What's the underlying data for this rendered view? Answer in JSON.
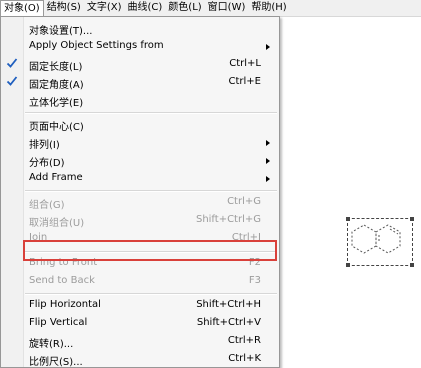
{
  "menubar": {
    "items": [
      {
        "label": "对象(O)"
      },
      {
        "label": "结构(S)"
      },
      {
        "label": "文字(X)"
      },
      {
        "label": "曲线(C)"
      },
      {
        "label": "颜色(L)"
      },
      {
        "label": "窗口(W)"
      },
      {
        "label": "帮助(H)"
      }
    ]
  },
  "menu": {
    "items": [
      {
        "label": "对象设置(T)...",
        "shortcut": "",
        "checked": false,
        "submenu": false,
        "disabled": false
      },
      {
        "label": "Apply Object Settings from",
        "shortcut": "",
        "checked": false,
        "submenu": true,
        "disabled": false
      },
      {
        "label": "固定长度(L)",
        "shortcut": "Ctrl+L",
        "checked": true,
        "submenu": false,
        "disabled": false
      },
      {
        "label": "固定角度(A)",
        "shortcut": "Ctrl+E",
        "checked": true,
        "submenu": false,
        "disabled": false
      },
      {
        "label": "立体化学(E)",
        "shortcut": "",
        "checked": false,
        "submenu": false,
        "disabled": false
      },
      {
        "label": "页面中心(C)",
        "shortcut": "",
        "checked": false,
        "submenu": false,
        "disabled": false
      },
      {
        "label": "排列(I)",
        "shortcut": "",
        "checked": false,
        "submenu": true,
        "disabled": false
      },
      {
        "label": "分布(D)",
        "shortcut": "",
        "checked": false,
        "submenu": true,
        "disabled": false
      },
      {
        "label": "Add Frame",
        "shortcut": "",
        "checked": false,
        "submenu": true,
        "disabled": false
      },
      {
        "label": "组合(G)",
        "shortcut": "Ctrl+G",
        "checked": false,
        "submenu": false,
        "disabled": true
      },
      {
        "label": "取消组合(U)",
        "shortcut": "Shift+Ctrl+G",
        "checked": false,
        "submenu": false,
        "disabled": true
      },
      {
        "label": "Join",
        "shortcut": "Ctrl+J",
        "checked": false,
        "submenu": false,
        "disabled": true
      },
      {
        "label": "Bring to Front",
        "shortcut": "F2",
        "checked": false,
        "submenu": false,
        "disabled": true
      },
      {
        "label": "Send to Back",
        "shortcut": "F3",
        "checked": false,
        "submenu": false,
        "disabled": true
      },
      {
        "label": "Flip Horizontal",
        "shortcut": "Shift+Ctrl+H",
        "checked": false,
        "submenu": false,
        "disabled": false
      },
      {
        "label": "Flip Vertical",
        "shortcut": "Shift+Ctrl+V",
        "checked": false,
        "submenu": false,
        "disabled": false
      },
      {
        "label": "旋转(R)...",
        "shortcut": "Ctrl+R",
        "checked": false,
        "submenu": false,
        "disabled": false
      },
      {
        "label": "比例尺(S)...",
        "shortcut": "Ctrl+K",
        "checked": false,
        "submenu": false,
        "disabled": false
      }
    ]
  },
  "colors": {
    "highlight_box": "#d9403a",
    "disabled_text": "#9c9c9c",
    "check": "#1f5fbf"
  }
}
